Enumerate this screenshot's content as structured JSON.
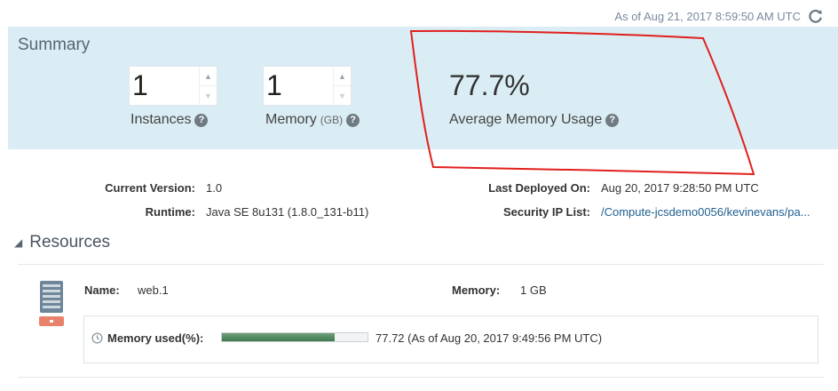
{
  "header": {
    "timestamp": "As of Aug 21, 2017 8:59:50 AM UTC",
    "refresh_icon": "refresh-icon"
  },
  "summary": {
    "title": "Summary",
    "instances": {
      "value": "1",
      "label": "Instances"
    },
    "memory": {
      "value": "1",
      "label": "Memory",
      "unit": "(GB)"
    },
    "avg_memory": {
      "value": "77.7%",
      "label": "Average Memory Usage"
    },
    "help_glyph": "?",
    "background_color": "#daedf4"
  },
  "annotation": {
    "stroke_color": "#e0201c",
    "description_icon": "red-hand-drawn-outline"
  },
  "details": {
    "current_version": {
      "label": "Current Version:",
      "value": "1.0"
    },
    "runtime": {
      "label": "Runtime:",
      "value": "Java SE 8u131 (1.8.0_131-b11)"
    },
    "last_deployed": {
      "label": "Last Deployed On:",
      "value": "Aug 20, 2017 9:28:50 PM UTC"
    },
    "security_ip": {
      "label": "Security IP List:",
      "value": "/Compute-jcsdemo0056/kevinevans/pa..."
    }
  },
  "resources": {
    "title": "Resources",
    "name_label": "Name:",
    "name_value": "web.1",
    "memory_label": "Memory:",
    "memory_value": "1 GB",
    "memory_used_label": "Memory used(%):",
    "memory_used_value": "77.72 (As of Aug 20, 2017 9:49:56 PM UTC)",
    "memory_used_fraction": 0.7772,
    "bar_color": "#3f7a4f"
  }
}
